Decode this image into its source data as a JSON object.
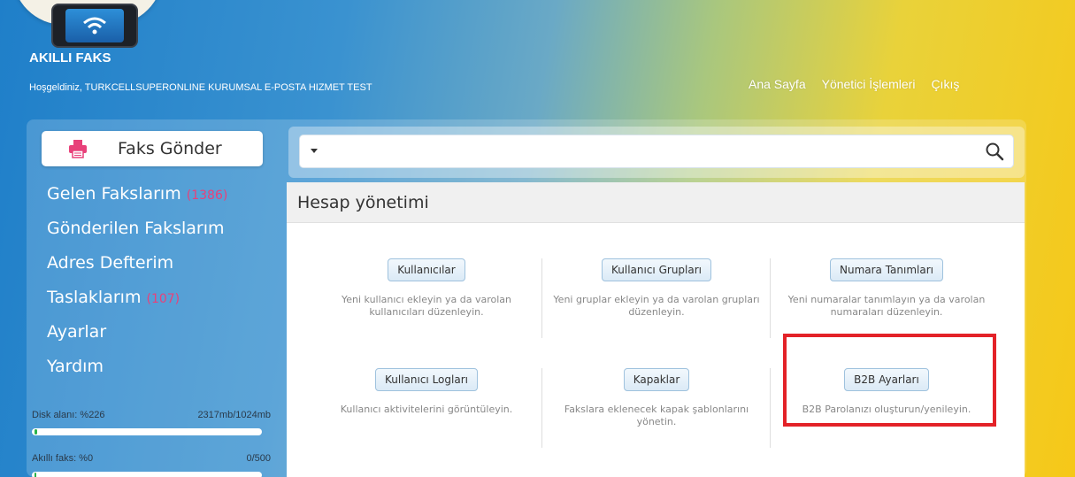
{
  "header": {
    "logo_text": "AKILLI FAKS",
    "welcome_text": "Hoşgeldiniz, TURKCELLSUPERONLINE KURUMSAL E-POSTA HIZMET TEST",
    "nav": [
      "Ana Sayfa",
      "Yönetici İşlemleri",
      "Çıkış"
    ]
  },
  "sidebar": {
    "send_fax_label": "Faks Gönder",
    "menu": [
      {
        "label": "Gelen Fakslarım",
        "count": "(1386)"
      },
      {
        "label": "Gönderilen Fakslarım",
        "count": ""
      },
      {
        "label": "Adres Defterim",
        "count": ""
      },
      {
        "label": "Taslaklarım",
        "count": "(107)"
      },
      {
        "label": "Ayarlar",
        "count": ""
      },
      {
        "label": "Yardım",
        "count": ""
      }
    ],
    "disk": {
      "label": "Disk alanı: %226",
      "value_text": "2317mb/1024mb",
      "percent": 226
    },
    "smart_fax": {
      "label": "Akıllı faks: %0",
      "value_text": "0/500",
      "percent": 0
    }
  },
  "search": {
    "value": "",
    "placeholder": ""
  },
  "panel": {
    "title": "Hesap yönetimi",
    "items": [
      {
        "button": "Kullanıcılar",
        "desc": "Yeni kullanıcı ekleyin ya da varolan kullanıcıları düzenleyin."
      },
      {
        "button": "Kullanıcı Grupları",
        "desc": "Yeni gruplar ekleyin ya da varolan grupları düzenleyin."
      },
      {
        "button": "Numara Tanımları",
        "desc": "Yeni numaralar tanımlayın ya da varolan numaraları düzenleyin."
      },
      {
        "button": "Kullanıcı Logları",
        "desc": "Kullanıcı aktivitelerini görüntüleyin."
      },
      {
        "button": "Kapaklar",
        "desc": "Fakslara eklenecek kapak şablonlarını yönetin."
      },
      {
        "button": "B2B Ayarları",
        "desc": "B2B Parolanızı oluşturun/yenileyin."
      }
    ]
  },
  "colors": {
    "highlight": "#e32228",
    "count": "#e8417a",
    "progress": "#2ab14a"
  },
  "icons": [
    "wifi-icon",
    "printer-icon",
    "search-icon",
    "caret-down-icon"
  ]
}
